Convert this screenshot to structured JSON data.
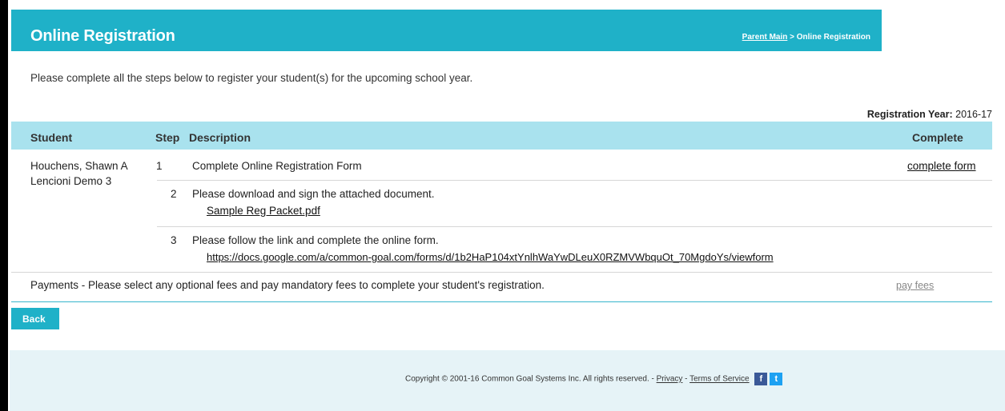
{
  "header": {
    "title": "Online Registration",
    "breadcrumb": {
      "parent": "Parent Main",
      "separator": " > ",
      "current": "Online Registration"
    }
  },
  "intro": "Please complete all the steps below to register your student(s) for the upcoming school year.",
  "registration_year": {
    "label": "Registration Year:",
    "value": "2016-17"
  },
  "table": {
    "columns": {
      "student": "Student",
      "step": "Step",
      "description": "Description",
      "complete": "Complete"
    },
    "student_name_line1": "Houchens, Shawn A",
    "student_name_line2": "Lencioni Demo 3",
    "rows": [
      {
        "step": "1",
        "description": "Complete Online Registration Form",
        "action": "complete form"
      },
      {
        "step": "2",
        "description": "Please download and sign the attached document.",
        "link": "Sample Reg Packet.pdf"
      },
      {
        "step": "3",
        "description": "Please follow the link and complete the online form.",
        "link": "https://docs.google.com/a/common-goal.com/forms/d/1b2HaP104xtYnlhWaYwDLeuX0RZMVWbquOt_70MgdoYs/viewform"
      }
    ],
    "payments": {
      "text": "Payments - Please select any optional fees and pay mandatory fees to complete your student's registration.",
      "action": "pay fees"
    }
  },
  "back_button": "Back",
  "footer": {
    "copyright": "Copyright © 2001-16 Common Goal Systems Inc. All rights reserved. - ",
    "privacy": "Privacy",
    "sep": " - ",
    "terms": "Terms of Service",
    "facebook_glyph": "f",
    "twitter_glyph": "t"
  },
  "colors": {
    "accent": "#1fb1c8",
    "table_header": "#a9e2ee",
    "footer_bg": "#e6f3f7"
  },
  "icons": [
    "facebook-icon",
    "twitter-icon"
  ]
}
